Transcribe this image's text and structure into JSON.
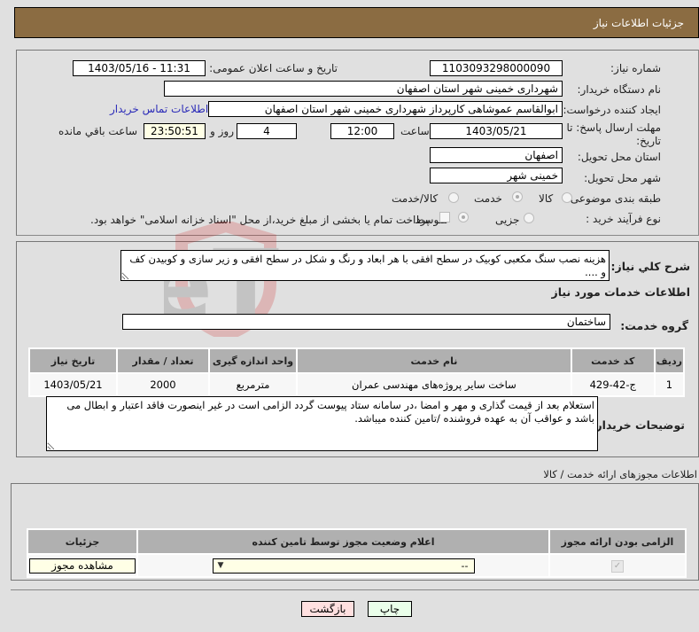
{
  "header": {
    "title": "جزئیات اطلاعات نیاز"
  },
  "form": {
    "need_number": {
      "label": "شماره نیاز:",
      "value": "1103093298000090"
    },
    "announce_datetime": {
      "label": "تاریخ و ساعت اعلان عمومی:",
      "value": "1403/05/16 - 11:31"
    },
    "buyer_org": {
      "label": "نام دستگاه خریدار:",
      "value": "شهرداری خمینی شهر استان اصفهان"
    },
    "requester": {
      "label": "ایجاد کننده درخواست:",
      "value": "ابوالقاسم عموشاهی کارپرداز شهرداری خمینی شهر استان اصفهان"
    },
    "buyer_contact_link": "اطلاعات تماس خریدار",
    "deadline": {
      "label_line1": "مهلت ارسال پاسخ: تا",
      "label_line2": "تاریخ:",
      "date": "1403/05/21",
      "time_label": "ساعت",
      "time": "12:00",
      "days": "4",
      "days_label": "روز و",
      "remaining": "23:50:51",
      "remaining_label": "ساعت باقي مانده"
    },
    "delivery_province": {
      "label": "استان محل تحویل:",
      "value": "اصفهان"
    },
    "delivery_city": {
      "label": "شهر محل تحویل:",
      "value": "خمینی شهر"
    },
    "category": {
      "label": "طبقه بندی موضوعی:",
      "options": [
        "کالا",
        "خدمت",
        "کالا/خدمت"
      ],
      "selected": "خدمت"
    },
    "purchase_type": {
      "label": "نوع فرآیند خرید :",
      "options": [
        "جزیی",
        "متوسط"
      ],
      "selected": "متوسط",
      "payment_note": "پرداخت تمام یا بخشی از مبلغ خرید،از محل \"اسناد خزانه اسلامی\" خواهد بود."
    }
  },
  "details": {
    "summary_label": "شرح کلي نیاز:",
    "summary_value": "هزینه نصب سنگ مکعبی کوبیک در سطح افقی با هر ابعاد و رنگ و شکل در سطح افقی و زیر سازی و کوبیدن کف و ....",
    "services_title": "اطلاعات خدمات مورد نیاز",
    "service_group_label": "گروه خدمت:",
    "service_group_value": "ساختمان",
    "table": {
      "headers": [
        "ردیف",
        "کد خدمت",
        "نام خدمت",
        "واحد اندازه گیری",
        "تعداد / مقدار",
        "تاریخ نیاز"
      ],
      "rows": [
        [
          "1",
          "ج-42-429",
          "ساخت سایر پروژه‌های مهندسی عمران",
          "مترمربع",
          "2000",
          "1403/05/21"
        ]
      ]
    },
    "buyer_notes_label": "توضیحات خریدار:",
    "buyer_notes_value": "استعلام بعد از قیمت گذاری و مهر و امضا ،در سامانه ستاد پیوست گردد الزامی است در غیر اینصورت فاقد اعتبار و ابطال می باشد و عواقب آن به عهده فروشنده /تامین کننده میباشد."
  },
  "permits": {
    "title": "اطلاعات مجوزهای ارائه خدمت / کالا",
    "headers": [
      "الزامی بودن ارائه مجوز",
      "اعلام وضعیت مجوز توسط تامین کننده",
      "جزئیات"
    ],
    "row": {
      "required_checked": true,
      "status_value": "--",
      "details_button": "مشاهده مجوز"
    }
  },
  "buttons": {
    "print": "چاپ",
    "back": "بازگشت"
  },
  "watermark": {
    "text": "AriaTender.neT"
  }
}
